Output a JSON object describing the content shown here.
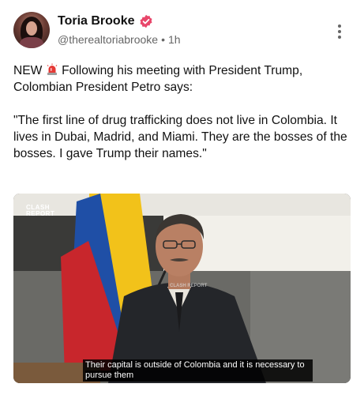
{
  "author": {
    "name": "Toria Brooke",
    "handle": "@therealtoriabrooke",
    "separator": "•",
    "time": "1h"
  },
  "icons": {
    "verified": "verified-badge-icon",
    "more": "more-vertical-icon",
    "siren": "police-siren-emoji-icon"
  },
  "colors": {
    "verified": "#e8466a",
    "siren": "#e53935"
  },
  "post": {
    "line1_prefix": "NEW",
    "line1_suffix": "Following his meeting with President Trump, Colombian President Petro says:",
    "quote": "\"The first line of drug trafficking does not live in Colombia. It lives in Dubai, Madrid, and Miami. They are the bosses of the bosses. I gave Trump their names.\""
  },
  "media": {
    "watermark_top_a": "CLASH",
    "watermark_top_b": "REPORT",
    "watermark_center": "CLASH REPORT",
    "caption_line1": "Their capital is outside of Colombia and it is necessary to",
    "caption_line2": "pursue them"
  }
}
